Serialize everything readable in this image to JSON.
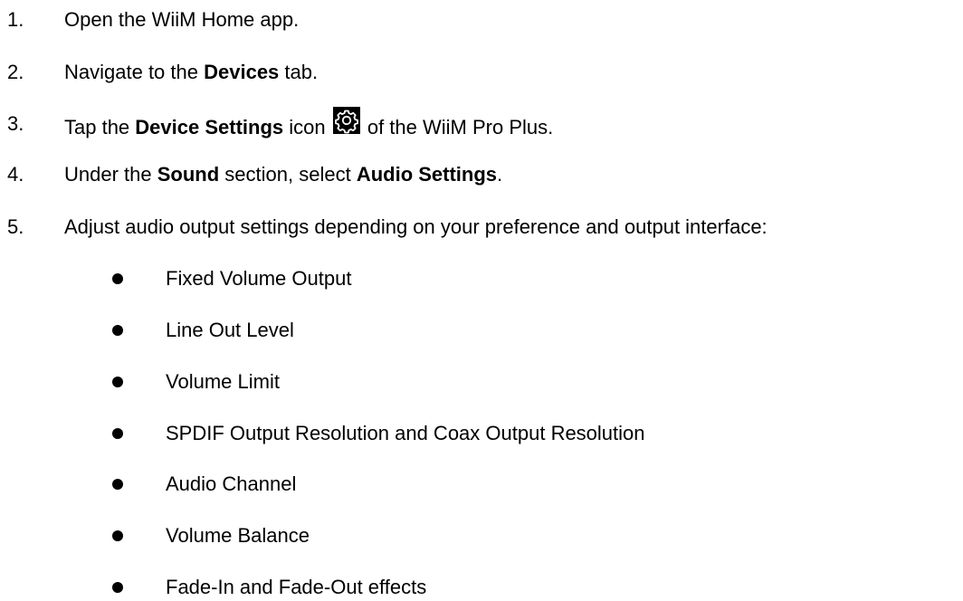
{
  "steps": [
    {
      "number": "1.",
      "text": "Open the WiiM Home app."
    },
    {
      "number": "2.",
      "pre": "Navigate to the ",
      "bold": "Devices",
      "post": " tab."
    },
    {
      "number": "3.",
      "pre": "Tap the ",
      "bold": "Device Settings",
      "mid": " icon ",
      "post": " of the WiiM Pro Plus.",
      "icon": "gear-icon"
    },
    {
      "number": "4.",
      "pre": "Under the ",
      "bold": "Sound",
      "mid": " section, select ",
      "bold2": "Audio Settings",
      "post": "."
    },
    {
      "number": "5.",
      "text": "Adjust audio output settings depending on your preference and output interface:"
    }
  ],
  "options": [
    "Fixed Volume Output",
    "Line Out Level",
    "Volume Limit",
    "SPDIF Output Resolution and Coax Output Resolution",
    "Audio Channel",
    "Volume Balance",
    "Fade-In and Fade-Out effects"
  ]
}
